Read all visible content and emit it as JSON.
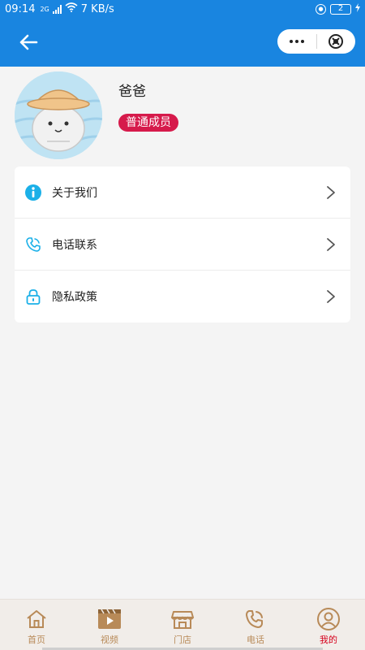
{
  "status_bar": {
    "time": "09:14",
    "network_type": "2G",
    "speed": "7 KB/s",
    "battery": "2"
  },
  "profile": {
    "name": "爸爸",
    "member_level": "普通成员"
  },
  "menu": [
    {
      "label": "关于我们",
      "icon": "info-icon"
    },
    {
      "label": "电话联系",
      "icon": "phone-icon"
    },
    {
      "label": "隐私政策",
      "icon": "lock-icon"
    }
  ],
  "tabs": [
    {
      "label": "首页",
      "icon": "home-icon"
    },
    {
      "label": "视频",
      "icon": "video-icon"
    },
    {
      "label": "门店",
      "icon": "store-icon"
    },
    {
      "label": "电话",
      "icon": "phone-icon"
    },
    {
      "label": "我的",
      "icon": "user-icon"
    }
  ],
  "colors": {
    "header": "#1985e0",
    "badge": "#d61a4b",
    "tab_inactive": "#b88a58",
    "tab_active": "#d6001c",
    "menu_icon": "#1bb0e8"
  }
}
